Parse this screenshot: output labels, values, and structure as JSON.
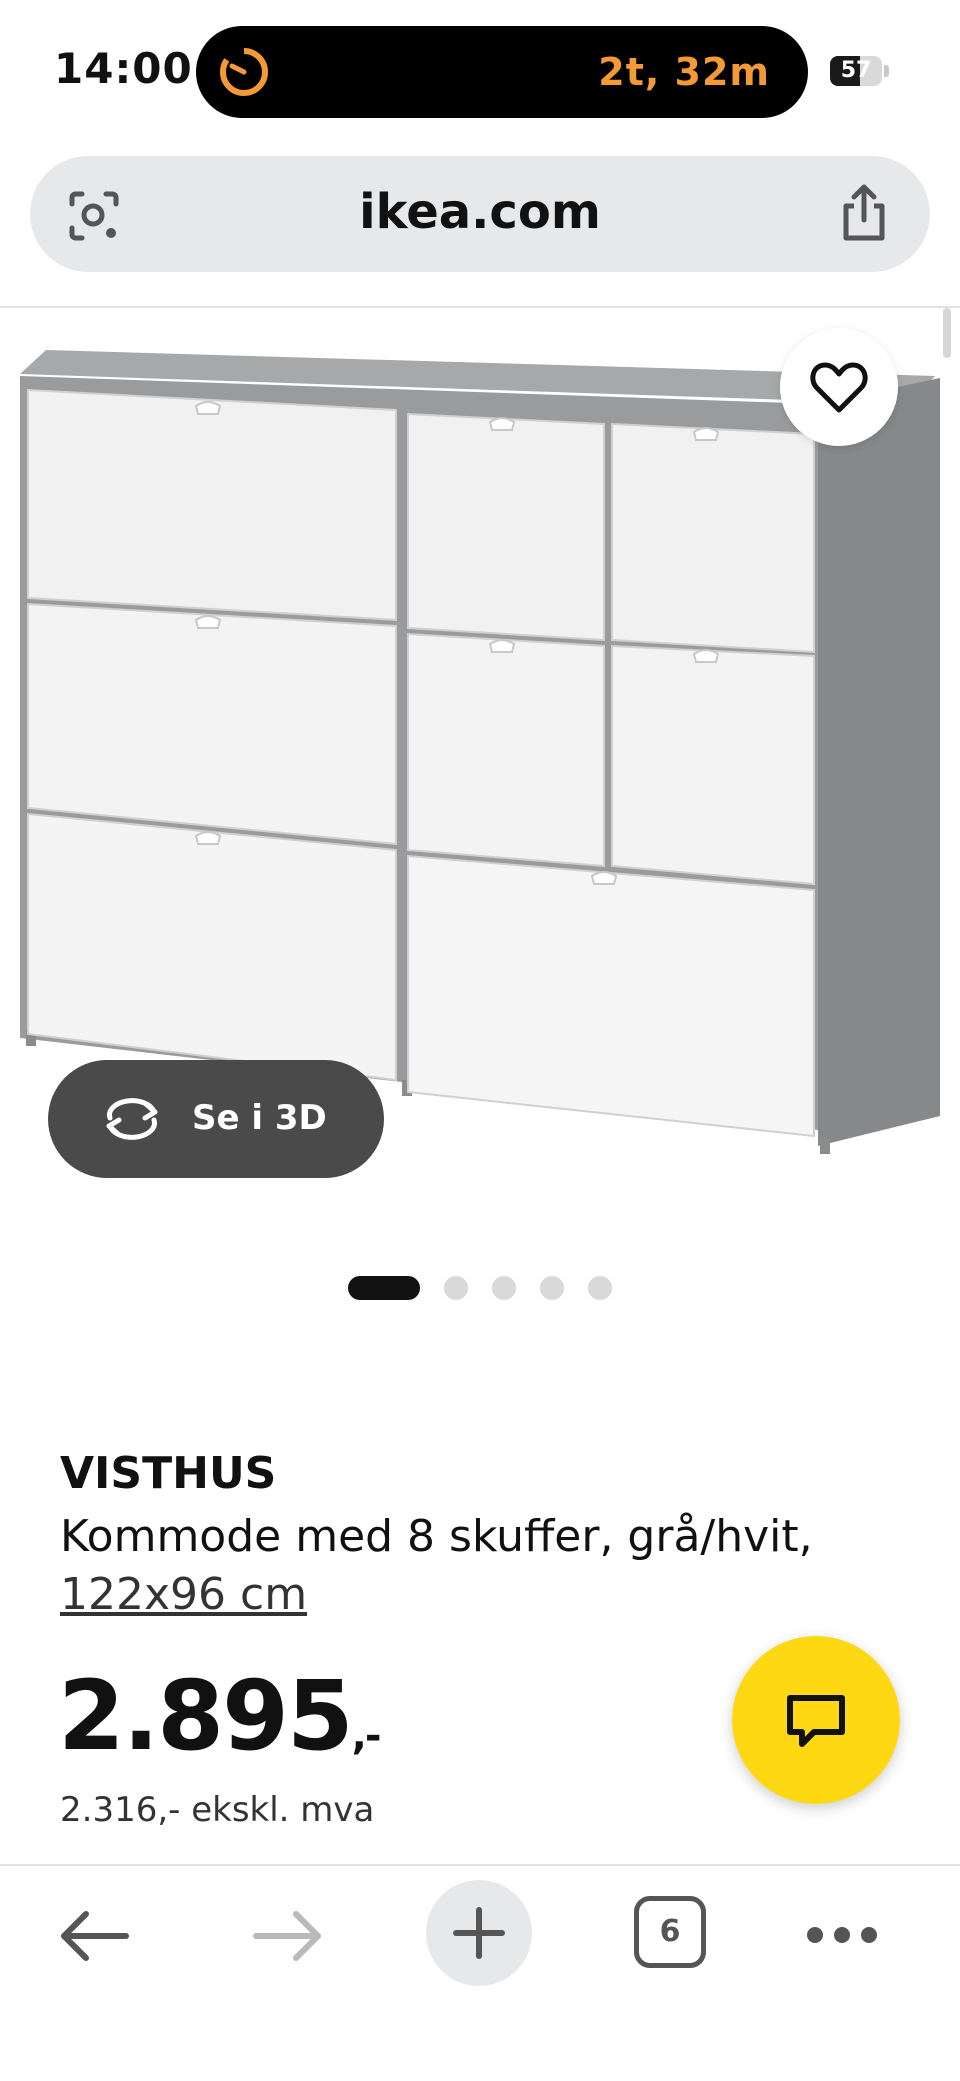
{
  "status_bar": {
    "time": "14:00",
    "timer": "2t, 32m",
    "battery": "57",
    "battery_level": 0.57,
    "timer_icon": "timer-icon"
  },
  "browser": {
    "url": "ikea.com",
    "lens_icon": "visual-search-icon",
    "share_icon": "share-icon"
  },
  "product": {
    "view_3d_label": "Se i 3D",
    "favorite_icon": "heart-icon",
    "carousel": {
      "total": 5,
      "active_index": 0
    },
    "brand": "VISTHUS",
    "description": "Kommode med 8 skuffer, grå/hvit,",
    "dimensions": "122x96 cm",
    "price": "2.895",
    "price_suffix": ",-",
    "price_excl_vat": "2.316,- ekskl. mva"
  },
  "chat": {
    "icon": "chat-icon",
    "color": "#ffd814"
  },
  "toolbar": {
    "tabs_count": "6",
    "icons": [
      "back-arrow-icon",
      "forward-arrow-icon",
      "plus-icon",
      "tabs-icon",
      "more-icon"
    ]
  },
  "colors": {
    "timer": "#f39a35",
    "island": "#000000",
    "urlbar": "#e7e8ea",
    "chat": "#ffd814"
  }
}
